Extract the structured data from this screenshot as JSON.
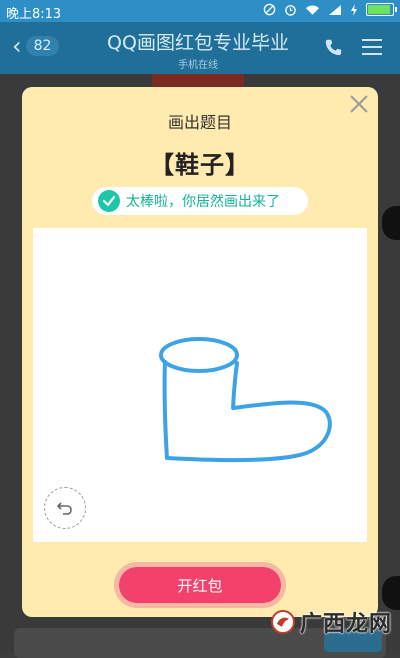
{
  "status_bar": {
    "time": "晚上8:13",
    "icons": [
      "do-not-disturb-icon",
      "alarm-icon",
      "wifi-icon",
      "signal-icon",
      "charging-icon",
      "battery-icon"
    ]
  },
  "header": {
    "back_icon": "chevron-left-icon",
    "unread_count": "82",
    "title": "QQ画图红包专业毕业",
    "subtitle": "手机在线",
    "call_icon": "phone-icon",
    "menu_icon": "menu-icon"
  },
  "dialog": {
    "heading": "画出题目",
    "answer": "【鞋子】",
    "success_message": "太棒啦，你居然画出来了",
    "success_icon": "check-circle-icon",
    "undo_icon": "undo-icon",
    "close_icon": "close-icon",
    "open_button_label": "开红包",
    "colors": {
      "dialog_bg": "#ffeab0",
      "accent_green": "#1cc7a8",
      "button_pink": "#f2416a",
      "drawing_stroke": "#3ea2e6"
    }
  },
  "watermark": {
    "text": "广西龙网",
    "logo_icon": "site-logo-icon"
  }
}
